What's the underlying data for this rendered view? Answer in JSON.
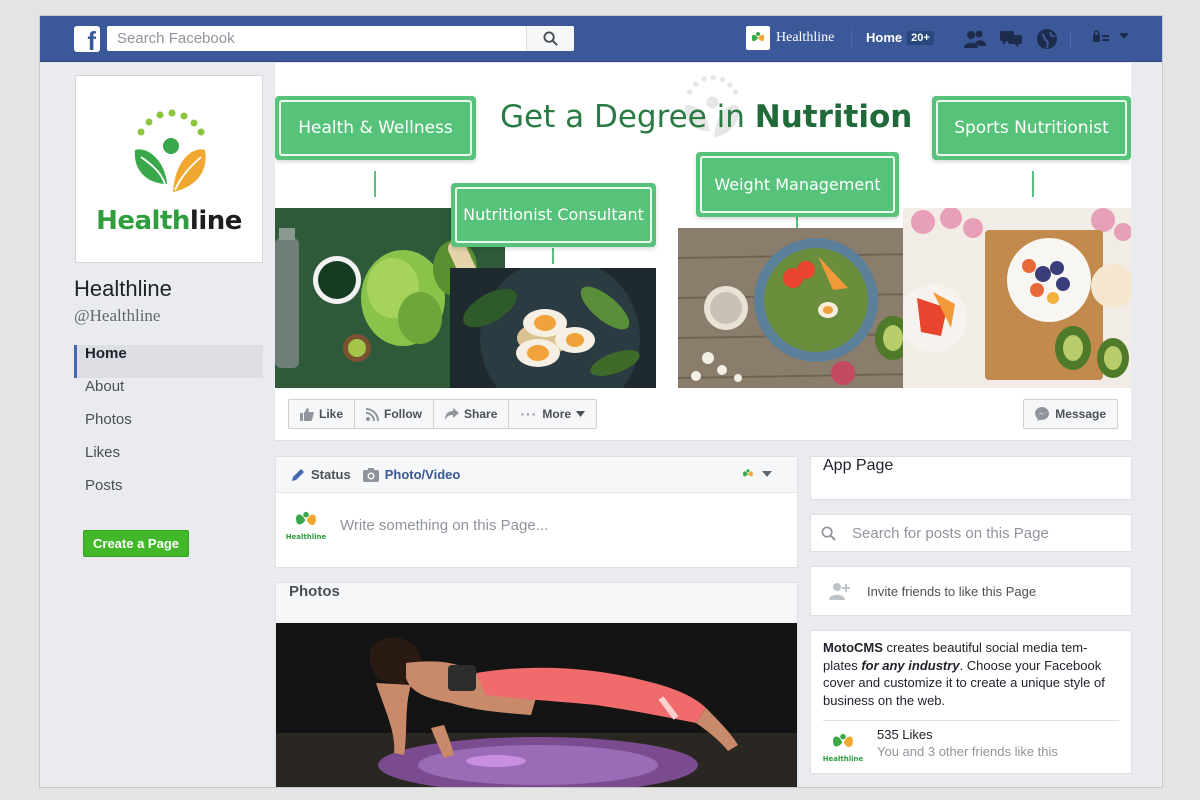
{
  "topbar": {
    "search_placeholder": "Search Facebook",
    "page_name": "Healthline",
    "home_label": "Home",
    "home_badge": "20+"
  },
  "profile": {
    "logo_text_green": "Health",
    "logo_text_dark": "line",
    "name": "Healthline",
    "handle": "@Healthline"
  },
  "nav": {
    "items": [
      {
        "label": "Home"
      },
      {
        "label": "About"
      },
      {
        "label": "Photos"
      },
      {
        "label": "Likes"
      },
      {
        "label": "Posts"
      }
    ],
    "create_page": "Create a Page"
  },
  "cover": {
    "title_prefix": "Get a Degree in ",
    "title_bold": "Nutrition",
    "tags": [
      "Health & Wellness",
      "Nutritionist Consultant",
      "Weight Management",
      "Sports Nutritionist"
    ]
  },
  "actions": {
    "like": "Like",
    "follow": "Follow",
    "share": "Share",
    "more": "More",
    "message": "Message"
  },
  "composer": {
    "status_tab": "Status",
    "photo_tab": "Photo/Video",
    "placeholder": "Write something on this Page...",
    "avatar_word": "Healthline"
  },
  "photos": {
    "header": "Photos"
  },
  "sidebar": {
    "app_page": "App Page",
    "search_placeholder": "Search for posts on this Page",
    "invite": "Invite friends to like this Page",
    "about_brand": "MotoCMS",
    "about_part1": " creates beautiful social media tem-plates ",
    "about_italic": "for any industry",
    "about_part2": ". Choose your Facebook cover and customize it to create a unique style of business on the web.",
    "likes_count": "535 Likes",
    "likes_sub": "You and 3 other friends like this"
  },
  "colors": {
    "fb_blue": "#3b5998",
    "brand_green": "#56c27a",
    "cta_green": "#42b72a"
  }
}
